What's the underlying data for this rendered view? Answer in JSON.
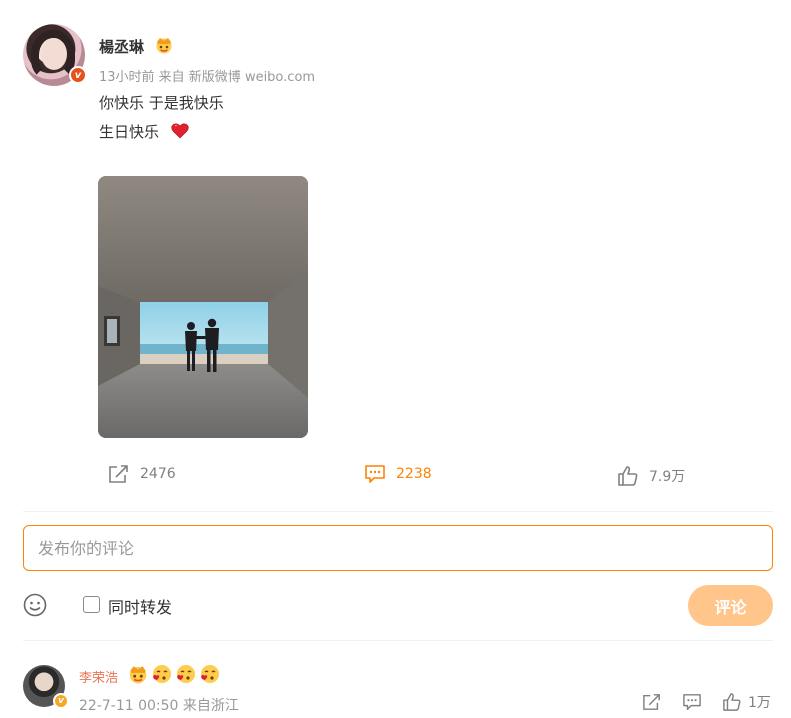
{
  "post": {
    "author": "楊丞琳",
    "meta": "13小时前  来自 新版微博 weibo.com",
    "text_line1": "你快乐 于是我快乐",
    "text_line2": "生日快乐",
    "image_alt": "two people holding hands silhouetted at the end of a concrete tunnel facing the sea"
  },
  "actions": {
    "repost_count": "2476",
    "comment_count": "2238",
    "like_count": "7.9万"
  },
  "composer": {
    "placeholder": "发布你的评论",
    "repost_label": "同时转发",
    "submit_label": "评论"
  },
  "comment": {
    "author": "李荣浩",
    "meta": "22-7-11 00:50 来自浙江",
    "like_count": "1万"
  },
  "colors": {
    "accent": "#ff8200",
    "submit_disabled": "#ffc58a",
    "comment_name": "#eb7350"
  }
}
